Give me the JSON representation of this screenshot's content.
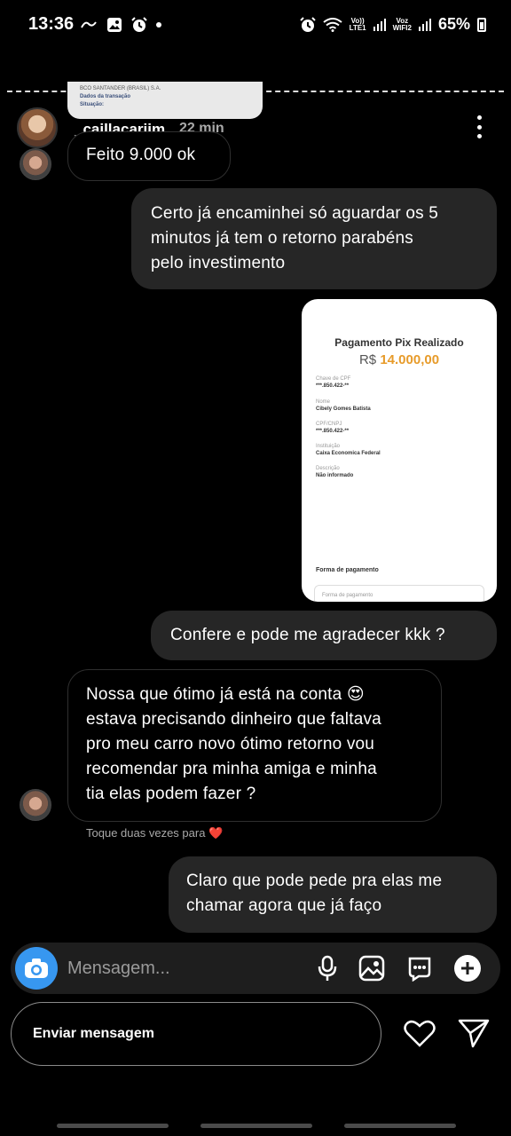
{
  "status_bar": {
    "time": "13:36",
    "net_top_1": "Vo))",
    "net_bottom_1": "LTE1",
    "net_top_2": "Voz",
    "net_bottom_2": "WIFI2",
    "battery": "65%"
  },
  "shared_receipt_preview": {
    "bank": "BCO SANTANDER (BRASIL) S.A.",
    "section": "Dados da transação",
    "status": "Situação:"
  },
  "header": {
    "username": "_caillacariim",
    "time_ago": "22 min"
  },
  "messages": {
    "m1": [
      "Feito 9.000 ok"
    ],
    "m2": [
      "Certo já encaminhei só aguardar os 5",
      "minutos já tem o retorno parabéns",
      "pelo investimento"
    ],
    "m3": [
      "Confere e pode me agradecer kkk ?"
    ],
    "m4": [
      "Nossa que ótimo já está na conta 😍",
      "estava precisando dinheiro que faltava",
      "pro meu carro novo ótimo retorno vou",
      "recomendar pra minha amiga e minha",
      "tia elas podem fazer ?"
    ],
    "m5": [
      "Claro que pode pede pra elas me",
      "chamar agora que já faço"
    ]
  },
  "receipt": {
    "title": "Pagamento Pix Realizado",
    "currency": "R$",
    "amount": "14.000,00",
    "fields": [
      {
        "label": "Chave de CPF",
        "value": "***.850.422-**"
      },
      {
        "label": "Nome",
        "value": "Cibely Gomes Batista"
      },
      {
        "label": "CPF/CNPJ",
        "value": "***.850.422-**"
      },
      {
        "label": "Instituição",
        "value": "Caixa Economica Federal"
      },
      {
        "label": "Descrição",
        "value": "Não informado"
      }
    ],
    "payment_label": "Forma de pagamento",
    "payment_placeholder": "Forma de pagamento"
  },
  "hint": {
    "text": "Toque duas vezes para",
    "heart": "❤️"
  },
  "composer": {
    "placeholder": "Mensagem..."
  },
  "reply_bar": {
    "label": "Enviar mensagem"
  },
  "icons": {
    "camera": "camera-icon",
    "mic": "microphone-icon",
    "gallery": "gallery-icon",
    "sticker": "sticker-icon",
    "plus": "plus-icon",
    "heart": "heart-icon",
    "send": "send-icon",
    "more": "more-vertical-icon"
  },
  "colors": {
    "background": "#000000",
    "outgoing_bubble": "#262626",
    "accent_blue": "#3797f0",
    "amount_orange": "#e79b2a"
  }
}
